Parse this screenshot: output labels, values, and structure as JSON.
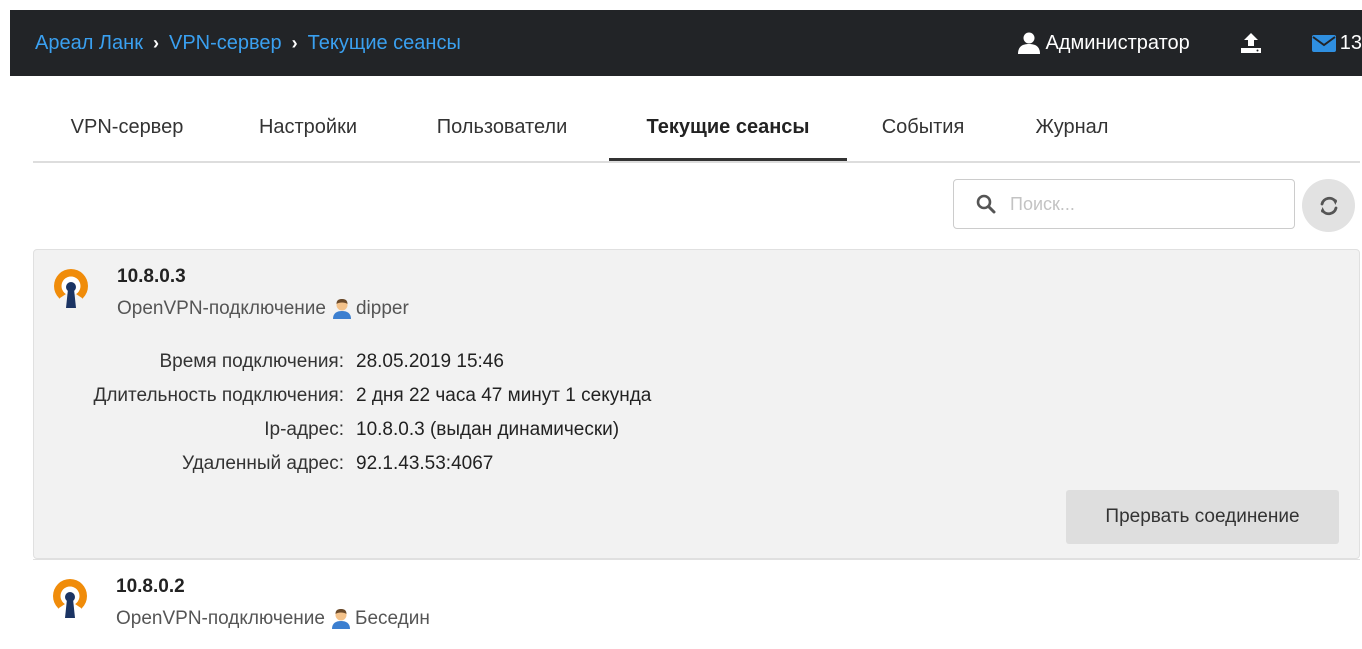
{
  "breadcrumb": [
    "Ареал Ланк",
    "VPN-сервер",
    "Текущие сеансы"
  ],
  "header": {
    "user_name": "Администратор",
    "mail_count": "13"
  },
  "tabs": [
    {
      "label": "VPN-сервер"
    },
    {
      "label": "Настройки"
    },
    {
      "label": "Пользователи"
    },
    {
      "label": "Текущие сеансы",
      "active": true
    },
    {
      "label": "События"
    },
    {
      "label": "Журнал"
    }
  ],
  "search": {
    "placeholder": "Поиск..."
  },
  "sessions": [
    {
      "ip": "10.8.0.3",
      "type": "OpenVPN-подключение",
      "user": "dipper",
      "details": [
        {
          "label": "Время подключения:",
          "value": "28.05.2019 15:46"
        },
        {
          "label": "Длительность подключения:",
          "value": "2 дня 22 часа 47 минут 1 секунда"
        },
        {
          "label": "Ip-адрес:",
          "value": "10.8.0.3 (выдан динамически)"
        },
        {
          "label": "Удаленный адрес:",
          "value": "92.1.43.53:4067"
        }
      ],
      "terminate_label": "Прервать соединение"
    },
    {
      "ip": "10.8.0.2",
      "type": "OpenVPN-подключение",
      "user": "Беседин"
    }
  ],
  "colors": {
    "topbar_bg": "#222427",
    "breadcrumb_link": "#3aa0f0",
    "mail_icon": "#2f8fe0",
    "openvpn_orange": "#f08c0a",
    "openvpn_navy": "#1b3463"
  }
}
